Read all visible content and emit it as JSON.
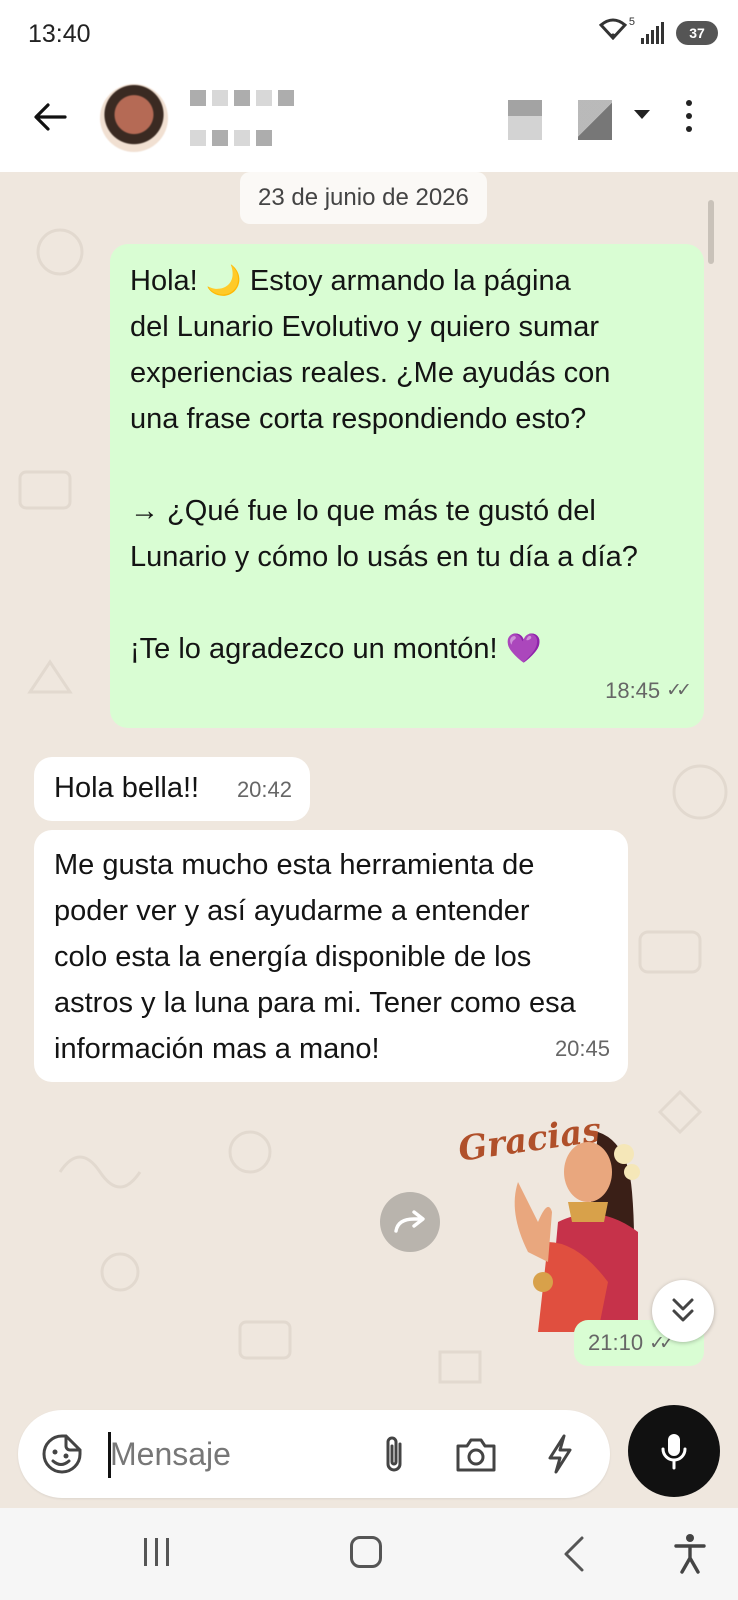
{
  "status_bar": {
    "time": "13:40",
    "wifi_badge": "5",
    "battery": "37"
  },
  "header": {
    "back_icon": "arrow-left-icon",
    "more_icon": "more-vertical-icon"
  },
  "chat": {
    "date": "23 de junio de 2026",
    "messages": [
      {
        "direction": "outgoing",
        "text": "Hola! 🌙 Estoy armando la página\ndel Lunario Evolutivo y quiero sumar\nexperiencias reales. ¿Me ayudás con\nuna frase corta respondiendo esto?\n\n→ ¿Qué fue lo que más te gustó del\nLunario y cómo lo usás en tu día a día?\n\n¡Te lo agradezco un montón! 💜",
        "time": "18:45",
        "ticks": "✓✓"
      },
      {
        "direction": "incoming",
        "text": "Hola bella!!",
        "time": "20:42"
      },
      {
        "direction": "incoming",
        "text": "Me gusta mucho esta herramienta de\npoder ver y así ayudarme a entender\ncolo esta la energía disponible de los\nastros y la luna para mi. Tener como esa\ninformación mas a mano!",
        "time": "20:45"
      }
    ],
    "sticker": {
      "caption": "Gracias",
      "time": "21:10",
      "ticks": "✓✓"
    }
  },
  "composer": {
    "placeholder": "Mensaje"
  },
  "colors": {
    "outgoing_bubble": "#d9fdd3",
    "incoming_bubble": "#ffffff",
    "chat_background": "#efe7de",
    "mic_button": "#111111"
  }
}
